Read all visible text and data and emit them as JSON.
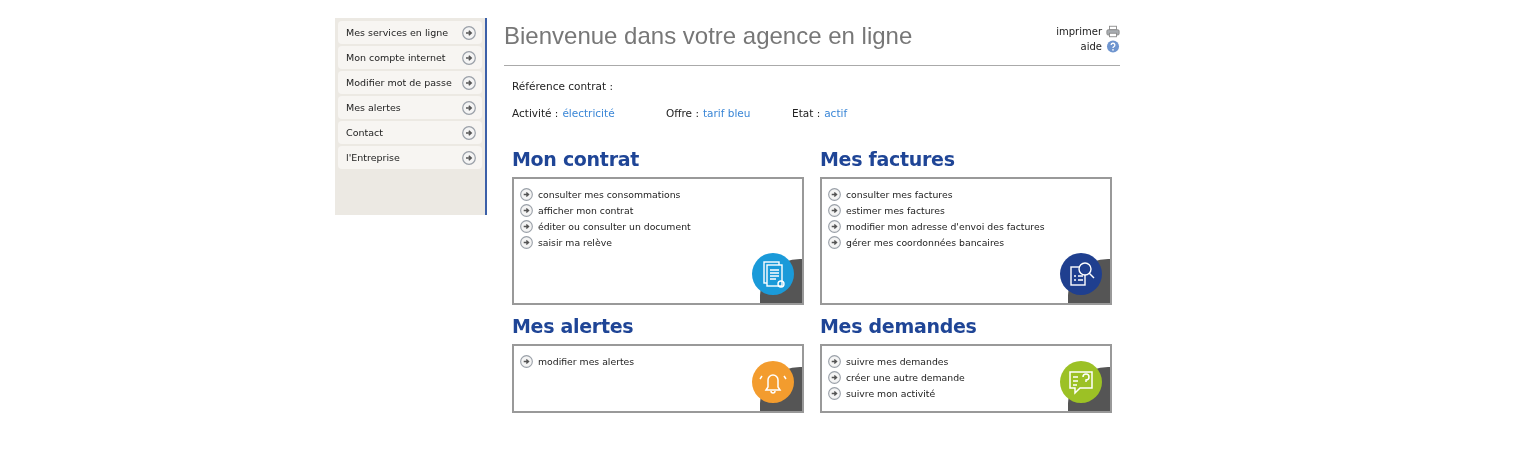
{
  "sidebar": {
    "items": [
      {
        "label": "Mes services en ligne"
      },
      {
        "label": "Mon compte internet"
      },
      {
        "label": "Modifier mot de passe"
      },
      {
        "label": "Mes alertes"
      },
      {
        "label": "Contact"
      },
      {
        "label": "l'Entreprise"
      }
    ]
  },
  "header": {
    "title": "Bienvenue dans votre agence en ligne",
    "print_link": "imprimer",
    "help_link": "aide"
  },
  "contract": {
    "reference_label": "Référence contrat :",
    "fields": [
      {
        "label": "Activité :",
        "value": "électricité"
      },
      {
        "label": "Offre :",
        "value": "tarif bleu"
      },
      {
        "label": "Etat :",
        "value": "actif"
      }
    ]
  },
  "sections": [
    {
      "title": "Mon contrat",
      "kind": "contract",
      "color": "#1a9ad9",
      "links": [
        "consulter mes consommations",
        "afficher mon contrat",
        "éditer ou consulter un document",
        "saisir ma relève"
      ]
    },
    {
      "title": "Mes factures",
      "kind": "invoice",
      "color": "#1f3f8f",
      "links": [
        "consulter mes factures",
        "estimer mes factures",
        "modifier mon adresse d'envoi des factures",
        "gérer mes coordonnées bancaires"
      ]
    },
    {
      "title": "Mes alertes",
      "kind": "bell",
      "color": "#f39c2e",
      "links": [
        "modifier mes alertes"
      ]
    },
    {
      "title": "Mes demandes",
      "kind": "question",
      "color": "#9cc125",
      "links": [
        "suivre mes demandes",
        "créer une autre demande",
        "suivre mon activité"
      ]
    }
  ]
}
